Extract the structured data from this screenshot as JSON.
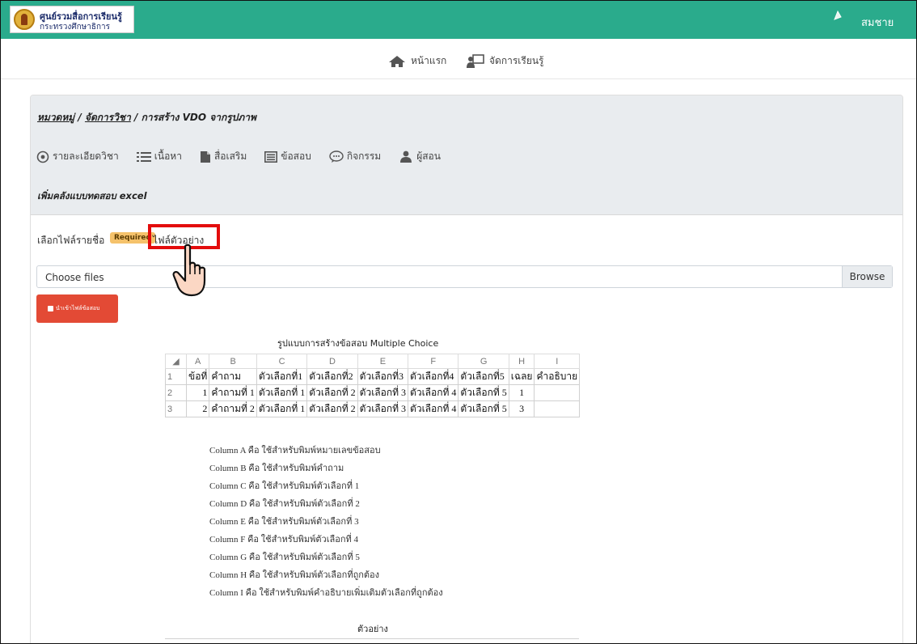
{
  "header": {
    "logo_title": "ศูนย์รวมสื่อการเรียนรู้",
    "logo_subtitle": "กระทรวงศึกษาธิการ",
    "user_name": "สมชาย",
    "brand_color": "#2aab8c"
  },
  "nav": {
    "home_label": "หน้าแรก",
    "manage_label": "จัดการเรียนรู้"
  },
  "breadcrumb": {
    "category": "หมวดหมู่",
    "manage_subject": "จัดการวิชา",
    "current": "การสร้าง VDO จากรูปภาพ",
    "separator": " / "
  },
  "menu": {
    "items": [
      {
        "label": "รายละเอียดวิชา",
        "icon": "gear-icon"
      },
      {
        "label": "เนื้อหา",
        "icon": "list-icon"
      },
      {
        "label": "สื่อเสริม",
        "icon": "file-icon"
      },
      {
        "label": "ข้อสอบ",
        "icon": "table-icon"
      },
      {
        "label": "กิจกรรม",
        "icon": "chat-icon"
      },
      {
        "label": "ผู้สอน",
        "icon": "users-icon"
      }
    ]
  },
  "section_title": "เพิ่มคลังแบบทดสอบ excel",
  "upload": {
    "label": "เลือกไฟล์รายชื่อ",
    "required_badge": "Required",
    "sample_link": "ไฟล์ตัวอย่าง",
    "placeholder": "Choose files",
    "browse_label": "Browse",
    "import_button": "นำเข้าไฟล์ข้อสอบ"
  },
  "example": {
    "title": "รูปแบบการสร้างข้อสอบ Multiple Choice",
    "column_letters": [
      "A",
      "B",
      "C",
      "D",
      "E",
      "F",
      "G",
      "H",
      "I"
    ],
    "rows": [
      {
        "row": "1",
        "cells": [
          "ข้อที่",
          "คำถาม",
          "ตัวเลือกที่1",
          "ตัวเลือกที่2",
          "ตัวเลือกที่3",
          "ตัวเลือกที่4",
          "ตัวเลือกที่5",
          "เฉลย",
          "คำอธิบาย"
        ]
      },
      {
        "row": "2",
        "cells": [
          "1",
          "คำถามที่ 1",
          "ตัวเลือกที่ 1",
          "ตัวเลือกที่ 2",
          "ตัวเลือกที่ 3",
          "ตัวเลือกที่ 4",
          "ตัวเลือกที่ 5",
          "1",
          ""
        ]
      },
      {
        "row": "3",
        "cells": [
          "2",
          "คำถามที่ 2",
          "ตัวเลือกที่ 1",
          "ตัวเลือกที่ 2",
          "ตัวเลือกที่ 3",
          "ตัวเลือกที่ 4",
          "ตัวเลือกที่ 5",
          "3",
          ""
        ]
      }
    ],
    "descriptions": [
      "Column A คือ ใช้สำหรับพิมพ์หมายเลขข้อสอบ",
      "Column B คือ ใช้สำหรับพิมพ์คำถาม",
      "Column C คือ ใช้สำหรับพิมพ์ตัวเลือกที่ 1",
      "Column D คือ ใช้สำหรับพิมพ์ตัวเลือกที่ 2",
      "Column E คือ ใช้สำหรับพิมพ์ตัวเลือกที่ 3",
      "Column F คือ ใช้สำหรับพิมพ์ตัวเลือกที่ 4",
      "Column G คือ ใช้สำหรับพิมพ์ตัวเลือกที่ 5",
      "Column H คือ ใช้สำหรับพิมพ์ตัวเลือกที่ถูกต้อง",
      "Column I คือ ใช้สำหรับพิมพ์คำอธิบายเพิ่มเติมตัวเลือกที่ถูกต้อง"
    ],
    "sample_label": "ตัวอย่าง"
  }
}
